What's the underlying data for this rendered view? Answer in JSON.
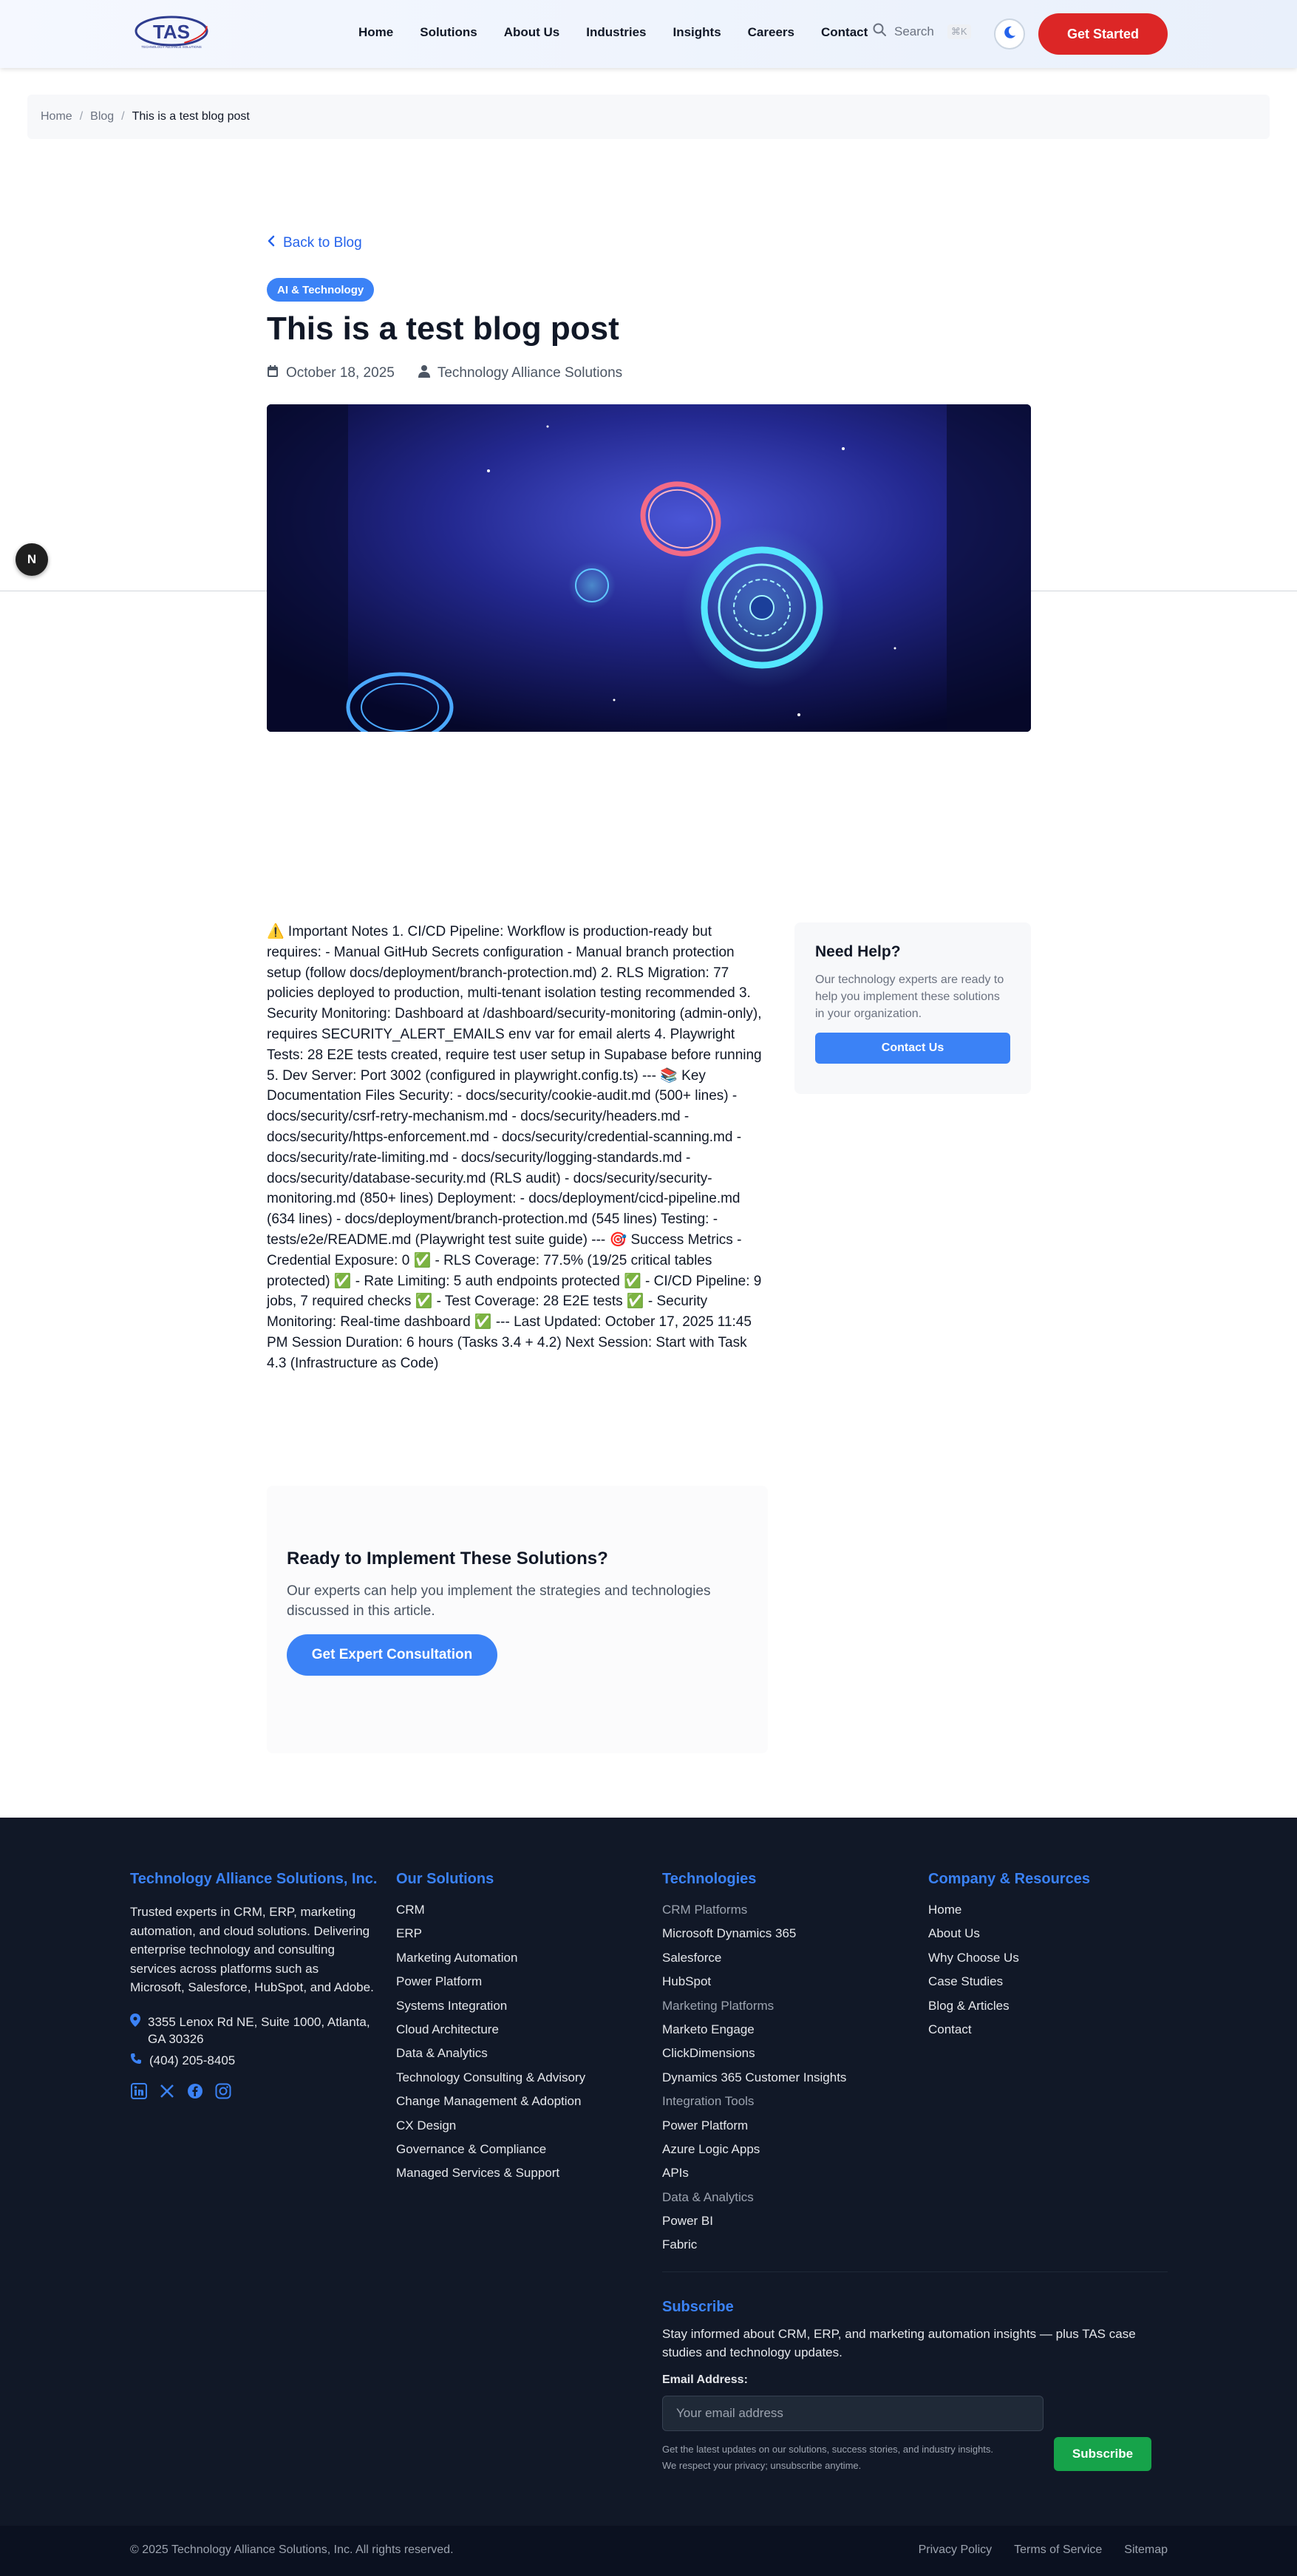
{
  "header": {
    "logo_text": "TAS",
    "logo_sub": "TECHNOLOGY ALLIANCE SOLUTIONS",
    "nav": [
      "Home",
      "Solutions",
      "About Us",
      "Industries",
      "Insights",
      "Careers",
      "Contact"
    ],
    "search_label": "Search",
    "search_shortcut": "⌘K",
    "cta": "Get Started"
  },
  "breadcrumb": {
    "items": [
      "Home",
      "Blog"
    ],
    "separator": "/",
    "current": "This is a test blog post"
  },
  "article": {
    "back_link": "Back to Blog",
    "category": "AI & Technology",
    "title": "This is a test blog post",
    "date": "October 18, 2025",
    "author": "Technology Alliance Solutions",
    "body": "⚠️ Important Notes 1. CI/CD Pipeline: Workflow is production-ready but requires: - Manual GitHub Secrets configuration - Manual branch protection setup (follow docs/deployment/branch-protection.md) 2. RLS Migration: 77 policies deployed to production, multi-tenant isolation testing recommended 3. Security Monitoring: Dashboard at /dashboard/security-monitoring (admin-only), requires SECURITY_ALERT_EMAILS env var for email alerts 4. Playwright Tests: 28 E2E tests created, require test user setup in Supabase before running 5. Dev Server: Port 3002 (configured in playwright.config.ts) --- 📚 Key Documentation Files Security: - docs/security/cookie-audit.md (500+ lines) - docs/security/csrf-retry-mechanism.md - docs/security/headers.md - docs/security/https-enforcement.md - docs/security/credential-scanning.md - docs/security/rate-limiting.md - docs/security/logging-standards.md - docs/security/database-security.md (RLS audit) - docs/security/security-monitoring.md (850+ lines) Deployment: - docs/deployment/cicd-pipeline.md (634 lines) - docs/deployment/branch-protection.md (545 lines) Testing: - tests/e2e/README.md (Playwright test suite guide) --- 🎯 Success Metrics - Credential Exposure: 0 ✅ - RLS Coverage: 77.5% (19/25 critical tables protected) ✅ - Rate Limiting: 5 auth endpoints protected ✅ - CI/CD Pipeline: 9 jobs, 7 required checks ✅ - Test Coverage: 28 E2E tests ✅ - Security Monitoring: Real-time dashboard ✅ --- Last Updated: October 17, 2025 11:45 PM Session Duration: 6 hours (Tasks 3.4 + 4.2) Next Session: Start with Task 4.3 (Infrastructure as Code)"
  },
  "help_card": {
    "title": "Need Help?",
    "text": "Our technology experts are ready to help you implement these solutions in your organization.",
    "button": "Contact Us"
  },
  "ready_box": {
    "title": "Ready to Implement These Solutions?",
    "text": "Our experts can help you implement the strategies and technologies discussed in this article.",
    "button": "Get Expert Consultation"
  },
  "footer": {
    "company": {
      "title": "Technology Alliance Solutions, Inc.",
      "about": "Trusted experts in CRM, ERP, marketing automation, and cloud solutions. Delivering enterprise technology and consulting services across platforms such as Microsoft, Salesforce, HubSpot, and Adobe.",
      "address": "3355 Lenox Rd NE, Suite 1000, Atlanta, GA 30326",
      "phone": "(404) 205-8405",
      "socials": [
        "linkedin-icon",
        "x-icon",
        "facebook-icon",
        "instagram-icon"
      ]
    },
    "solutions": {
      "title": "Our Solutions",
      "items": [
        "CRM",
        "ERP",
        "Marketing Automation",
        "Power Platform",
        "Systems Integration",
        "Cloud Architecture",
        "Data & Analytics",
        "Technology Consulting & Advisory",
        "Change Management & Adoption",
        "CX Design",
        "Governance & Compliance",
        "Managed Services & Support"
      ]
    },
    "technologies": {
      "title": "Technologies",
      "items": [
        {
          "label": "CRM Platforms",
          "group": true
        },
        {
          "label": "Microsoft Dynamics 365",
          "group": false
        },
        {
          "label": "Salesforce",
          "group": false
        },
        {
          "label": "HubSpot",
          "group": false
        },
        {
          "label": "Marketing Platforms",
          "group": true
        },
        {
          "label": "Marketo Engage",
          "group": false
        },
        {
          "label": "ClickDimensions",
          "group": false
        },
        {
          "label": "Dynamics 365 Customer Insights",
          "group": false
        },
        {
          "label": "Integration Tools",
          "group": true
        },
        {
          "label": "Power Platform",
          "group": false
        },
        {
          "label": "Azure Logic Apps",
          "group": false
        },
        {
          "label": "APIs",
          "group": false
        },
        {
          "label": "Data & Analytics",
          "group": true
        },
        {
          "label": "Power BI",
          "group": false
        },
        {
          "label": "Fabric",
          "group": false
        }
      ]
    },
    "company_resources": {
      "title": "Company & Resources",
      "items": [
        "Home",
        "About Us",
        "Why Choose Us",
        "Case Studies",
        "Blog & Articles",
        "Contact"
      ]
    },
    "subscribe": {
      "title": "Subscribe",
      "lead": "Stay informed about CRM, ERP, and marketing automation insights — plus TAS case studies and technology updates.",
      "label": "Email Address:",
      "placeholder": "Your email address",
      "fine_print_1": "Get the latest updates on our solutions, success stories, and industry insights.",
      "fine_print_2": "We respect your privacy; unsubscribe anytime.",
      "button": "Subscribe"
    },
    "copyright": "© 2025 Technology Alliance Solutions, Inc. All rights reserved.",
    "bottom_links": [
      "Privacy Policy",
      "Terms of Service",
      "Sitemap"
    ]
  },
  "colors": {
    "accent": "#3b82f6",
    "cta_red": "#dc2626",
    "subscribe_green": "#16a34a",
    "footer_bg": "#111827"
  }
}
